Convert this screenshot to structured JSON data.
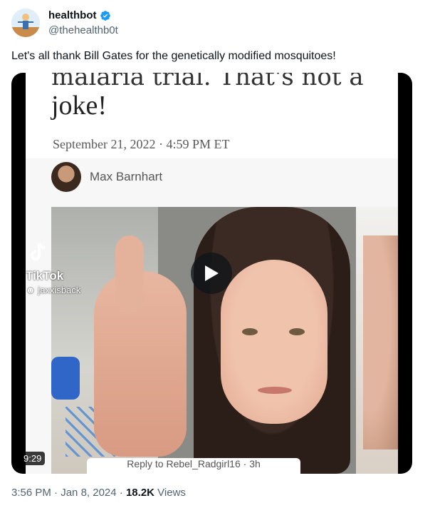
{
  "author": {
    "display_name": "healthbot",
    "handle": "@thehealthb0t",
    "verified_icon": "verified-badge-icon",
    "badge_color": "#1d9bf0"
  },
  "tweet": {
    "text": "Let's all thank Bill Gates for the genetically modified mosquitoes!"
  },
  "media": {
    "headline_partial": "malaria trial. That's not a",
    "headline_end": "joke!",
    "article_date": "September 21, 2022 · 4:59 PM ET",
    "article_author": "Max Barnhart",
    "watermark_logo": "tiktok-icon",
    "watermark_name": "TikTok",
    "watermark_user": "jaxxisback",
    "duration": "9:29",
    "reply_strip": "Reply to Rebel_Radgirl16 · 3h"
  },
  "footer": {
    "time": "3:56 PM",
    "separator": "·",
    "date": "Jan 8, 2024",
    "views_count": "18.2K",
    "views_label": "Views"
  }
}
